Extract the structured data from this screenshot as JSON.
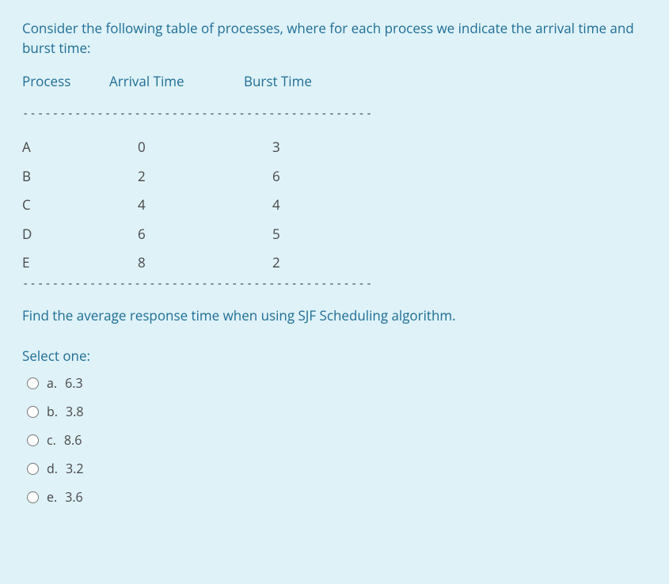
{
  "question": {
    "intro": "Consider the following table of processes, where for each process we indicate the arrival time and burst time:",
    "table": {
      "headers": {
        "process": "Process",
        "arrival": "Arrival Time",
        "burst": "Burst Time"
      },
      "rows": [
        {
          "process": "A",
          "arrival": "0",
          "burst": "3"
        },
        {
          "process": "B",
          "arrival": "2",
          "burst": "6"
        },
        {
          "process": "C",
          "arrival": "4",
          "burst": "4"
        },
        {
          "process": "D",
          "arrival": "6",
          "burst": "5"
        },
        {
          "process": "E",
          "arrival": "8",
          "burst": "2"
        }
      ]
    },
    "divider": "-----------------------------------------------",
    "prompt": "Find the average response time when using SJF Scheduling algorithm.",
    "select_one": "Select one:",
    "options": [
      {
        "letter": "a.",
        "text": "6.3"
      },
      {
        "letter": "b.",
        "text": "3.8"
      },
      {
        "letter": "c.",
        "text": "8.6"
      },
      {
        "letter": "d.",
        "text": "3.2"
      },
      {
        "letter": "e.",
        "text": "3.6"
      }
    ]
  }
}
